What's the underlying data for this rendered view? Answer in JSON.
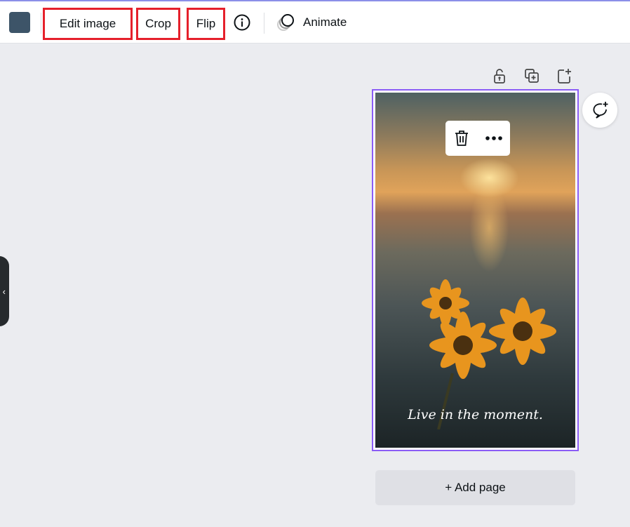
{
  "toolbar": {
    "color_swatch": "#3d5468",
    "edit_image": "Edit image",
    "crop": "Crop",
    "flip": "Flip",
    "animate": "Animate",
    "highlight_color": "#e5202b"
  },
  "page": {
    "caption": "Live in the moment.",
    "selection_color": "#8b5cf6"
  },
  "add_page": "+ Add page",
  "sidebar_toggle": "‹"
}
